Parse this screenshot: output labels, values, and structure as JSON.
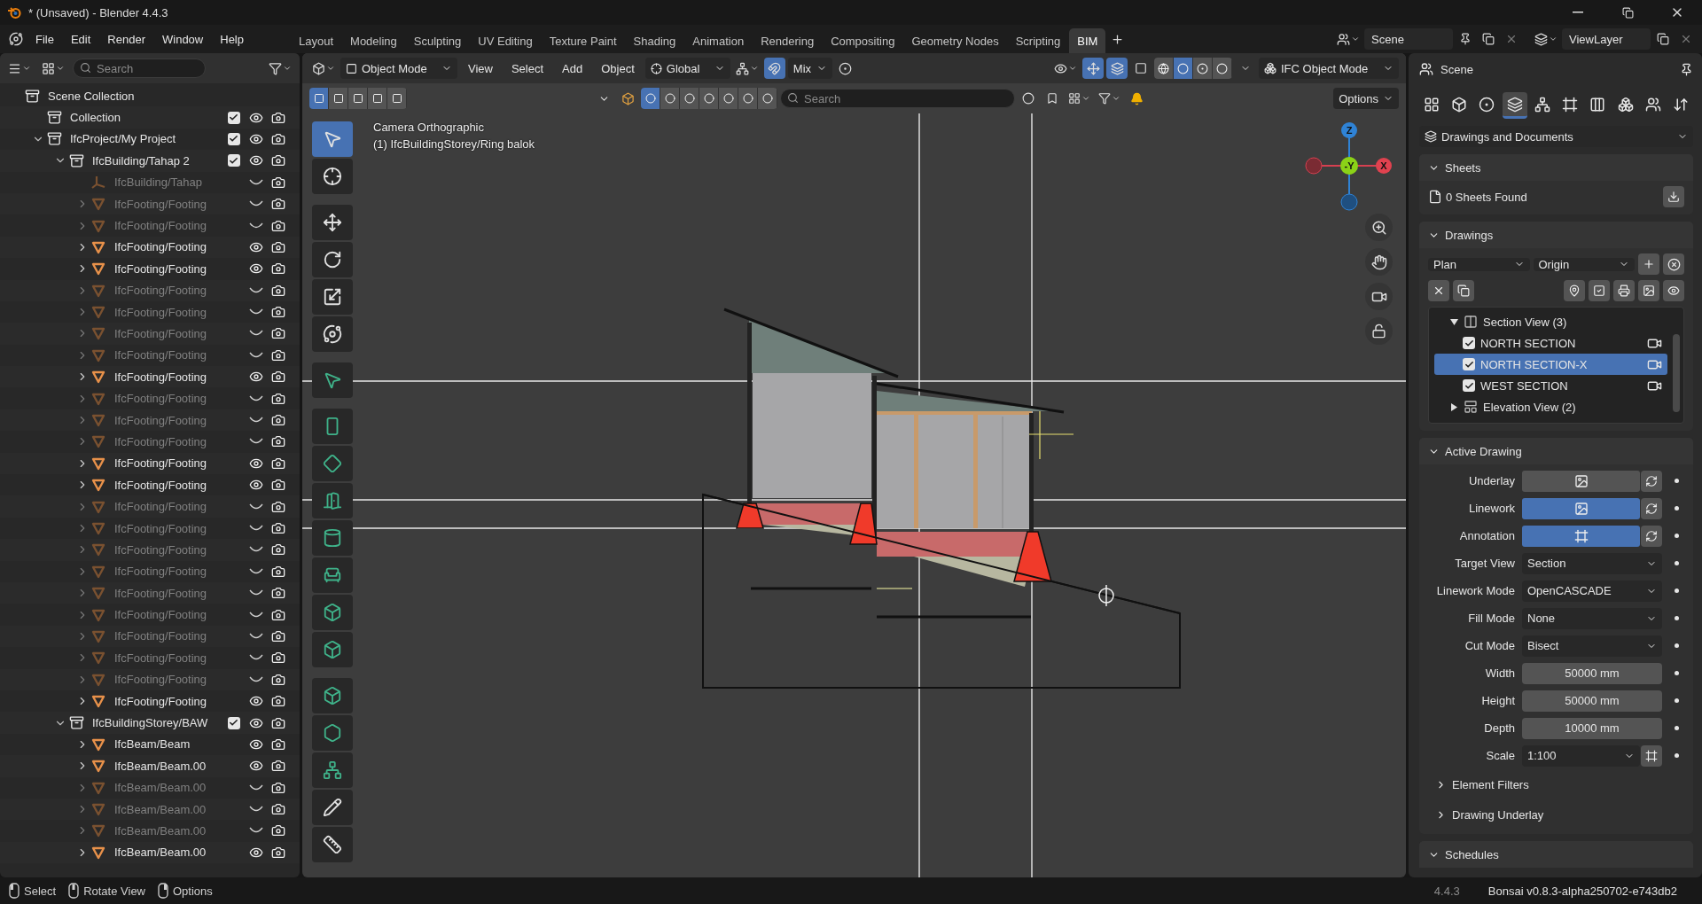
{
  "title_bar": {
    "title": "* (Unsaved) - Blender 4.4.3"
  },
  "menu": [
    "File",
    "Edit",
    "Render",
    "Window",
    "Help"
  ],
  "workspaces": [
    {
      "label": "Layout",
      "selected": false
    },
    {
      "label": "Modeling",
      "selected": false
    },
    {
      "label": "Sculpting",
      "selected": false
    },
    {
      "label": "UV Editing",
      "selected": false
    },
    {
      "label": "Texture Paint",
      "selected": false
    },
    {
      "label": "Shading",
      "selected": false
    },
    {
      "label": "Animation",
      "selected": false
    },
    {
      "label": "Rendering",
      "selected": false
    },
    {
      "label": "Compositing",
      "selected": false
    },
    {
      "label": "Geometry Nodes",
      "selected": false
    },
    {
      "label": "Scripting",
      "selected": false
    },
    {
      "label": "BIM",
      "selected": true
    }
  ],
  "scene": {
    "value": "Scene"
  },
  "view_layer": {
    "value": "ViewLayer"
  },
  "outliner": {
    "search": {
      "placeholder": "Search"
    },
    "tree": [
      {
        "kind": "collection",
        "label": "Scene Collection",
        "children": [
          {
            "kind": "collection",
            "label": "Collection",
            "checked": true,
            "visible": true
          },
          {
            "kind": "collection",
            "label": "IfcProject/My Project",
            "expanded": true,
            "checked": true,
            "visible": true,
            "children": [
              {
                "kind": "collection",
                "label": "IfcBuilding/Tahap 2",
                "expanded": true,
                "checked": true,
                "visible": true,
                "children": [
                  {
                    "kind": "empty",
                    "label": "IfcBuilding/Tahap",
                    "visible": false
                  },
                  {
                    "kind": "mesh",
                    "label": "IfcFooting/Footing",
                    "expanded": false,
                    "visible": false
                  },
                  {
                    "kind": "mesh",
                    "label": "IfcFooting/Footing",
                    "expanded": false,
                    "visible": false
                  },
                  {
                    "kind": "mesh",
                    "label": "IfcFooting/Footing",
                    "expanded": false,
                    "visible": true
                  },
                  {
                    "kind": "mesh",
                    "label": "IfcFooting/Footing",
                    "expanded": false,
                    "visible": true
                  },
                  {
                    "kind": "mesh",
                    "label": "IfcFooting/Footing",
                    "expanded": false,
                    "visible": false
                  },
                  {
                    "kind": "mesh",
                    "label": "IfcFooting/Footing",
                    "expanded": false,
                    "visible": false
                  },
                  {
                    "kind": "mesh",
                    "label": "IfcFooting/Footing",
                    "expanded": false,
                    "visible": false
                  },
                  {
                    "kind": "mesh",
                    "label": "IfcFooting/Footing",
                    "expanded": false,
                    "visible": false
                  },
                  {
                    "kind": "mesh",
                    "label": "IfcFooting/Footing",
                    "expanded": false,
                    "visible": true
                  },
                  {
                    "kind": "mesh",
                    "label": "IfcFooting/Footing",
                    "expanded": false,
                    "visible": false
                  },
                  {
                    "kind": "mesh",
                    "label": "IfcFooting/Footing",
                    "expanded": false,
                    "visible": false
                  },
                  {
                    "kind": "mesh",
                    "label": "IfcFooting/Footing",
                    "expanded": false,
                    "visible": false
                  },
                  {
                    "kind": "mesh",
                    "label": "IfcFooting/Footing",
                    "expanded": false,
                    "visible": true
                  },
                  {
                    "kind": "mesh",
                    "label": "IfcFooting/Footing",
                    "expanded": false,
                    "visible": true
                  },
                  {
                    "kind": "mesh",
                    "label": "IfcFooting/Footing",
                    "expanded": false,
                    "visible": false
                  },
                  {
                    "kind": "mesh",
                    "label": "IfcFooting/Footing",
                    "expanded": false,
                    "visible": false
                  },
                  {
                    "kind": "mesh",
                    "label": "IfcFooting/Footing",
                    "expanded": false,
                    "visible": false
                  },
                  {
                    "kind": "mesh",
                    "label": "IfcFooting/Footing",
                    "expanded": false,
                    "visible": false
                  },
                  {
                    "kind": "mesh",
                    "label": "IfcFooting/Footing",
                    "expanded": false,
                    "visible": false
                  },
                  {
                    "kind": "mesh",
                    "label": "IfcFooting/Footing",
                    "expanded": false,
                    "visible": false
                  },
                  {
                    "kind": "mesh",
                    "label": "IfcFooting/Footing",
                    "expanded": false,
                    "visible": false
                  },
                  {
                    "kind": "mesh",
                    "label": "IfcFooting/Footing",
                    "expanded": false,
                    "visible": false
                  },
                  {
                    "kind": "mesh",
                    "label": "IfcFooting/Footing",
                    "expanded": false,
                    "visible": false
                  },
                  {
                    "kind": "mesh",
                    "label": "IfcFooting/Footing",
                    "expanded": false,
                    "visible": true
                  }
                ]
              },
              {
                "kind": "collection",
                "label": "IfcBuildingStorey/BAW",
                "expanded": true,
                "checked": true,
                "visible": true,
                "children": [
                  {
                    "kind": "mesh",
                    "label": "IfcBeam/Beam",
                    "expanded": false,
                    "visible": true
                  },
                  {
                    "kind": "mesh",
                    "label": "IfcBeam/Beam.00",
                    "expanded": false,
                    "visible": true
                  },
                  {
                    "kind": "mesh",
                    "label": "IfcBeam/Beam.00",
                    "expanded": false,
                    "visible": false
                  },
                  {
                    "kind": "mesh",
                    "label": "IfcBeam/Beam.00",
                    "expanded": false,
                    "visible": false
                  },
                  {
                    "kind": "mesh",
                    "label": "IfcBeam/Beam.00",
                    "expanded": false,
                    "visible": false
                  },
                  {
                    "kind": "mesh",
                    "label": "IfcBeam/Beam.00",
                    "expanded": false,
                    "visible": true
                  }
                ]
              }
            ]
          }
        ]
      }
    ]
  },
  "viewport": {
    "mode": "Object Mode",
    "menus": [
      "View",
      "Select",
      "Add",
      "Object"
    ],
    "orientation": "Global",
    "snap_on": true,
    "snap_target": "Mix",
    "ifc_mode": "IFC Object Mode",
    "shading": [
      {
        "selected": false
      },
      {
        "selected": true
      },
      {
        "selected": false
      },
      {
        "selected": false
      }
    ],
    "select_modes": [
      {
        "selected": true
      },
      {
        "selected": false
      },
      {
        "selected": false
      },
      {
        "selected": false
      },
      {
        "selected": false
      }
    ],
    "search": {
      "placeholder": "Search"
    },
    "options": "Options",
    "overlay_text": [
      "Camera Orthographic",
      "(1) IfcBuildingStorey/Ring balok"
    ],
    "gizmo_axes": [
      "Z",
      "-Y",
      "X"
    ],
    "tools": [
      {
        "selected": true
      },
      {
        "selected": false
      },
      {
        "selected": false
      },
      {
        "selected": false
      },
      {
        "selected": false
      },
      {
        "selected": false
      },
      {
        "selected": false
      },
      {
        "selected": false
      },
      {
        "selected": false
      },
      {
        "selected": false
      },
      {
        "selected": false
      },
      {
        "selected": false
      },
      {
        "selected": false
      },
      {
        "selected": false
      },
      {
        "selected": false
      },
      {
        "selected": false
      },
      {
        "selected": false
      },
      {
        "selected": false
      },
      {
        "selected": false
      }
    ]
  },
  "properties": {
    "context": "Scene",
    "tabs": [
      {
        "selected": false
      },
      {
        "selected": false
      },
      {
        "selected": false
      },
      {
        "selected": true
      },
      {
        "selected": false
      },
      {
        "selected": false
      },
      {
        "selected": false
      },
      {
        "selected": false
      },
      {
        "selected": false
      },
      {
        "selected": false
      }
    ],
    "category": "Drawings and Documents",
    "sheets": {
      "title": "Sheets",
      "expanded": true,
      "status": "0 Sheets Found"
    },
    "drawings": {
      "title": "Drawings",
      "expanded": true,
      "drawing_type": "Plan",
      "origin": "Origin",
      "list": [
        {
          "kind": "group",
          "label": "Section View (3)",
          "expanded": true,
          "children": [
            {
              "kind": "drawing",
              "label": "NORTH SECTION",
              "checked": true,
              "selected": false
            },
            {
              "kind": "drawing",
              "label": "NORTH SECTION-X",
              "checked": true,
              "selected": true
            },
            {
              "kind": "drawing",
              "label": "WEST SECTION",
              "checked": true,
              "selected": false
            }
          ]
        },
        {
          "kind": "group",
          "label": "Elevation View (2)",
          "expanded": false
        }
      ]
    },
    "active_drawing": {
      "title": "Active Drawing",
      "expanded": true,
      "toggles": [
        {
          "label": "Underlay",
          "on": false
        },
        {
          "label": "Linework",
          "on": true
        },
        {
          "label": "Annotation",
          "on": true
        }
      ],
      "fields": [
        {
          "kind": "dropdown",
          "label": "Target View",
          "value": "Section"
        },
        {
          "kind": "dropdown",
          "label": "Linework Mode",
          "value": "OpenCASCADE"
        },
        {
          "kind": "dropdown",
          "label": "Fill Mode",
          "value": "None"
        },
        {
          "kind": "dropdown",
          "label": "Cut Mode",
          "value": "Bisect"
        },
        {
          "kind": "number",
          "label": "Width",
          "value": "50000 mm"
        },
        {
          "kind": "number",
          "label": "Height",
          "value": "50000 mm"
        },
        {
          "kind": "number",
          "label": "Depth",
          "value": "10000 mm"
        },
        {
          "kind": "scale",
          "label": "Scale",
          "value": "1:100"
        }
      ]
    },
    "subpanels": [
      {
        "label": "Element Filters",
        "expanded": false
      },
      {
        "label": "Drawing Underlay",
        "expanded": false
      }
    ],
    "next_panel": {
      "label": "Schedules",
      "expanded": true
    }
  },
  "status_bar": {
    "hints": [
      "Select",
      "Rotate View",
      "Options"
    ],
    "version": "4.4.3",
    "addon": "Bonsai v0.8.3-alpha250702-e743db2"
  }
}
